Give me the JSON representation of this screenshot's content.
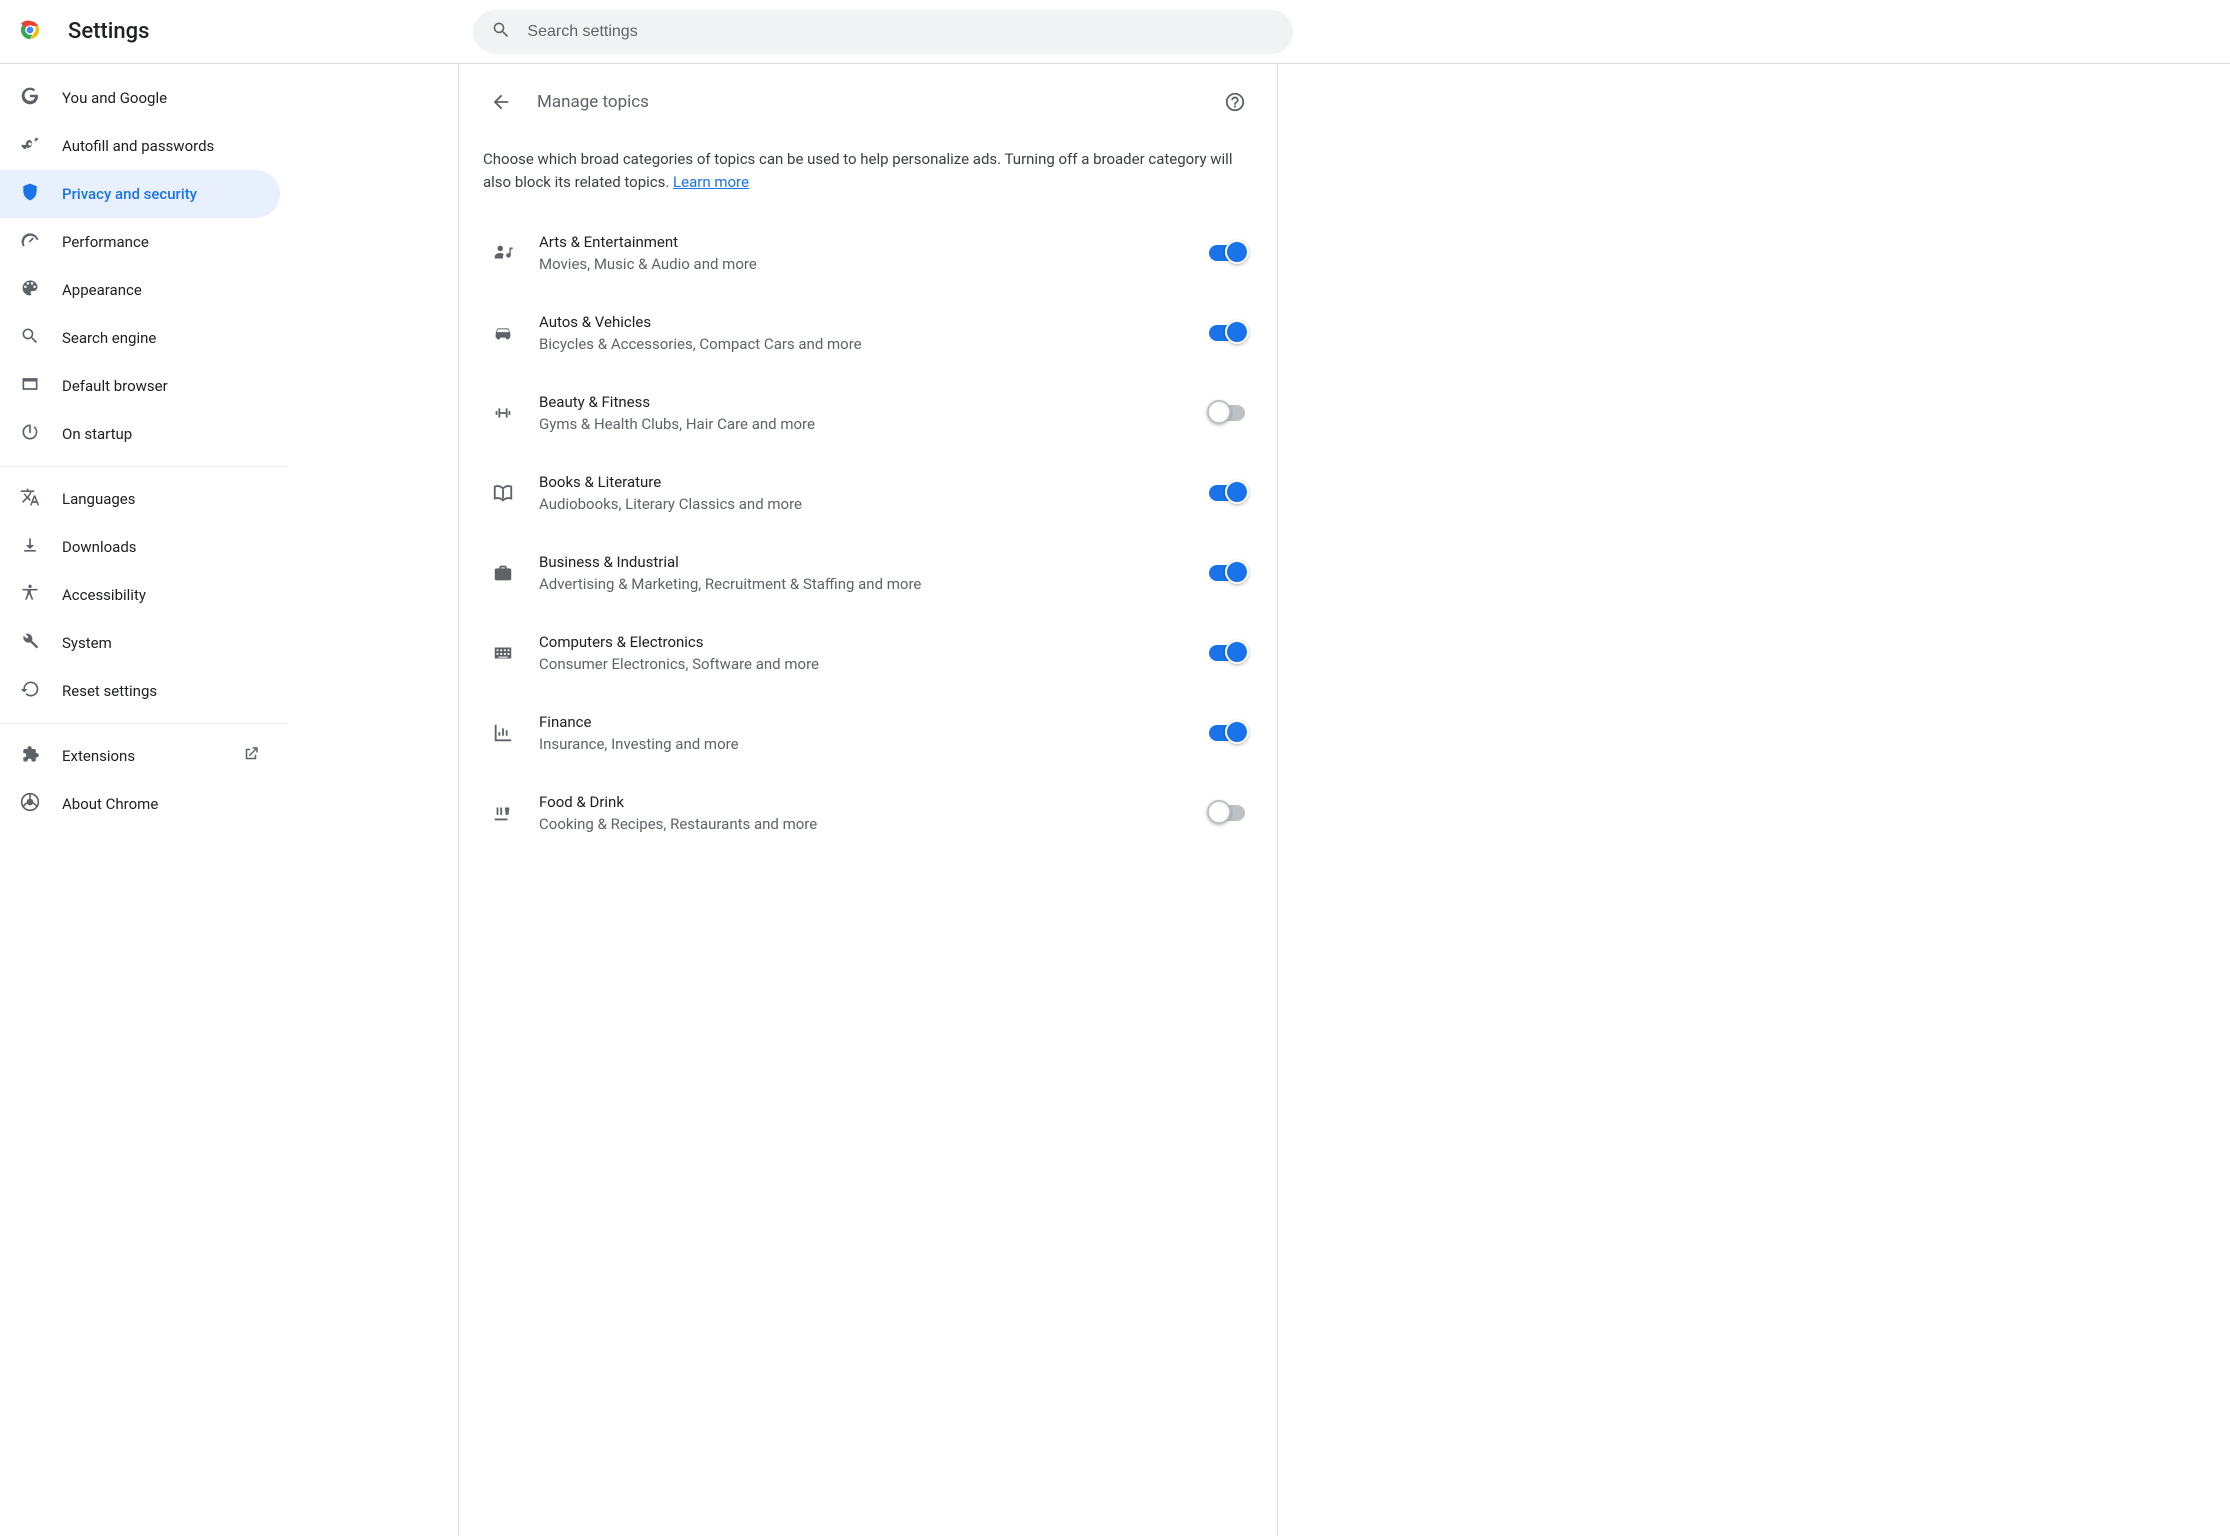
{
  "header": {
    "app_title": "Settings",
    "search_placeholder": "Search settings"
  },
  "sidebar": {
    "sections": [
      {
        "items": [
          {
            "id": "you-google",
            "icon": "g-logo",
            "label": "You and Google"
          },
          {
            "id": "autofill",
            "icon": "key",
            "label": "Autofill and passwords"
          },
          {
            "id": "privacy",
            "icon": "shield",
            "label": "Privacy and security",
            "active": true
          },
          {
            "id": "performance",
            "icon": "speed",
            "label": "Performance"
          },
          {
            "id": "appearance",
            "icon": "palette",
            "label": "Appearance"
          },
          {
            "id": "search-engine",
            "icon": "search",
            "label": "Search engine"
          },
          {
            "id": "default-browser",
            "icon": "browser",
            "label": "Default browser"
          },
          {
            "id": "startup",
            "icon": "power",
            "label": "On startup"
          }
        ]
      },
      {
        "items": [
          {
            "id": "languages",
            "icon": "translate",
            "label": "Languages"
          },
          {
            "id": "downloads",
            "icon": "download",
            "label": "Downloads"
          },
          {
            "id": "accessibility",
            "icon": "accessibility",
            "label": "Accessibility"
          },
          {
            "id": "system",
            "icon": "wrench",
            "label": "System"
          },
          {
            "id": "reset",
            "icon": "restore",
            "label": "Reset settings"
          }
        ]
      },
      {
        "items": [
          {
            "id": "extensions",
            "icon": "extension",
            "label": "Extensions",
            "external": true
          },
          {
            "id": "about",
            "icon": "chrome",
            "label": "About Chrome"
          }
        ]
      }
    ]
  },
  "page": {
    "title": "Manage topics",
    "intro_text": "Choose which broad categories of topics can be used to help personalize ads. Turning off a broader category will also block its related topics. ",
    "learn_more": "Learn more",
    "topics": [
      {
        "icon": "person-music",
        "title": "Arts & Entertainment",
        "sub": "Movies, Music & Audio and more",
        "on": true
      },
      {
        "icon": "car",
        "title": "Autos & Vehicles",
        "sub": "Bicycles & Accessories, Compact Cars and more",
        "on": true
      },
      {
        "icon": "fitness",
        "title": "Beauty & Fitness",
        "sub": "Gyms & Health Clubs, Hair Care and more",
        "on": false
      },
      {
        "icon": "book",
        "title": "Books & Literature",
        "sub": "Audiobooks, Literary Classics and more",
        "on": true
      },
      {
        "icon": "briefcase",
        "title": "Business & Industrial",
        "sub": "Advertising & Marketing, Recruitment & Staffing and more",
        "on": true
      },
      {
        "icon": "keyboard",
        "title": "Computers & Electronics",
        "sub": "Consumer Electronics, Software and more",
        "on": true
      },
      {
        "icon": "chart",
        "title": "Finance",
        "sub": "Insurance, Investing and more",
        "on": true
      },
      {
        "icon": "food",
        "title": "Food & Drink",
        "sub": "Cooking & Recipes, Restaurants and more",
        "on": false
      }
    ]
  }
}
